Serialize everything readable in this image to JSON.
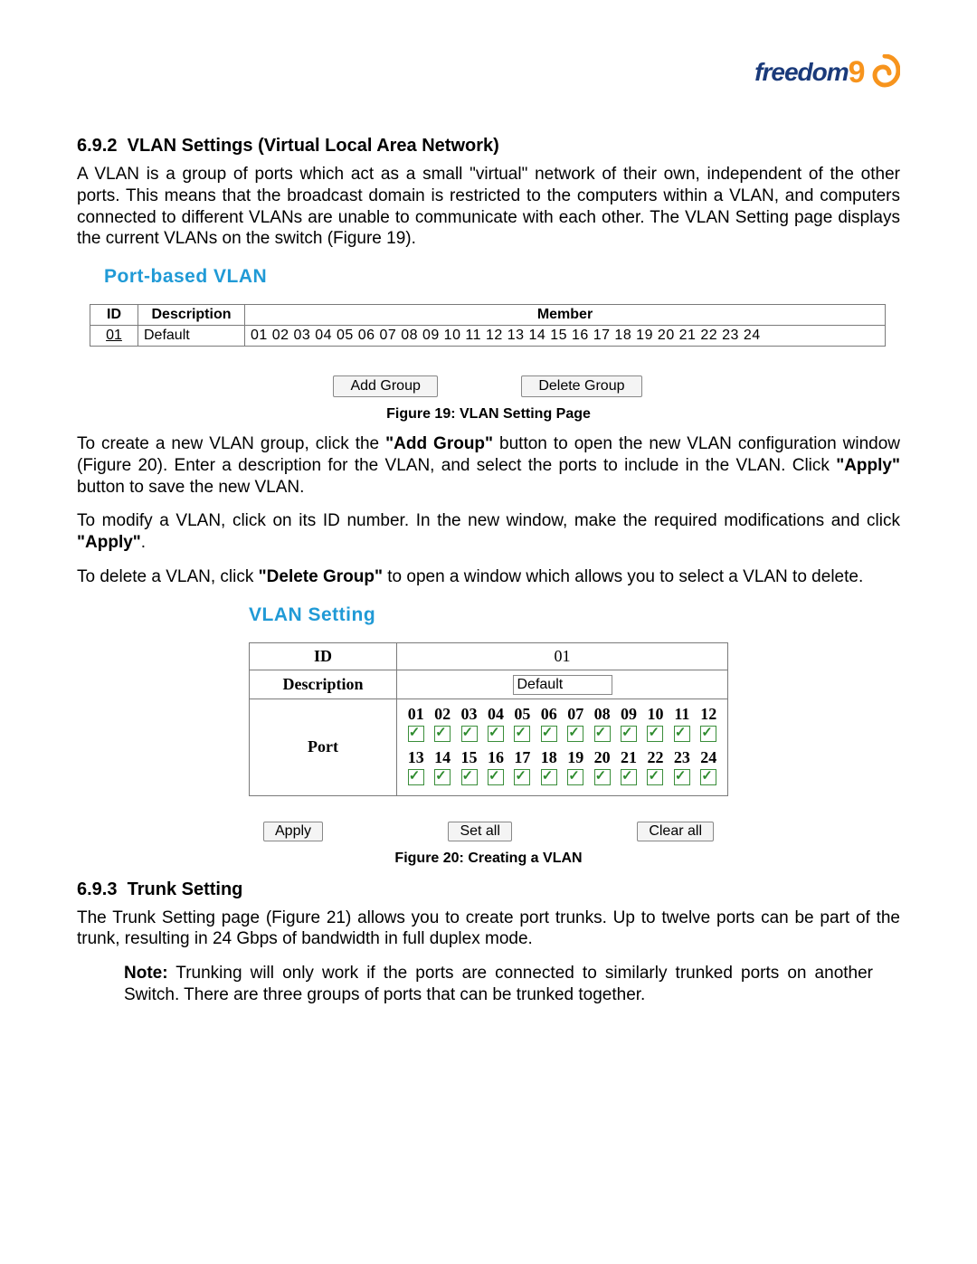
{
  "logo": {
    "brand": "freedom",
    "accent": "9"
  },
  "section_692": {
    "number": "6.9.2",
    "title": "VLAN Settings (Virtual Local Area Network)",
    "para": "A VLAN is a group of ports which act as a small \"virtual\" network of their own, independent of the other ports. This means that the broadcast domain is restricted to the computers within a VLAN, and computers connected to different VLANs are unable to communicate with each other.   The VLAN Setting page displays the current VLANs on the switch (Figure 19)."
  },
  "fig19": {
    "title": "Port-based VLAN",
    "headers": {
      "id": "ID",
      "desc": "Description",
      "member": "Member"
    },
    "row": {
      "id": "01",
      "desc": "Default",
      "member": "01 02 03 04 05 06 07 08 09 10 11 12 13 14 15 16 17 18 19 20 21 22 23 24"
    },
    "buttons": {
      "add": "Add Group",
      "del": "Delete Group"
    },
    "caption": "Figure 19: VLAN Setting Page"
  },
  "after_fig19": {
    "p1_a": "To create a new VLAN group, click the ",
    "p1_b": "\"Add Group\"",
    "p1_c": " button to open the new VLAN configuration window (Figure 20).  Enter a description for the VLAN, and select the ports to include in the VLAN.  Click ",
    "p1_d": "\"Apply\"",
    "p1_e": " button to save the new VLAN.",
    "p2_a": "To modify a VLAN, click on its ID number.  In the new window, make the required modifications and click ",
    "p2_b": "\"Apply\"",
    "p2_c": ".",
    "p3_a": "To delete a VLAN, click ",
    "p3_b": "\"Delete Group\"",
    "p3_c": " to open a window which allows you to select a VLAN to delete."
  },
  "fig20": {
    "title": "VLAN Setting",
    "labels": {
      "id": "ID",
      "desc": "Description",
      "port": "Port"
    },
    "id_value": "01",
    "desc_value": "Default",
    "ports_row1": [
      "01",
      "02",
      "03",
      "04",
      "05",
      "06",
      "07",
      "08",
      "09",
      "10",
      "11",
      "12"
    ],
    "ports_row2": [
      "13",
      "14",
      "15",
      "16",
      "17",
      "18",
      "19",
      "20",
      "21",
      "22",
      "23",
      "24"
    ],
    "buttons": {
      "apply": "Apply",
      "setall": "Set all",
      "clearall": "Clear all"
    },
    "caption": "Figure 20: Creating a VLAN"
  },
  "section_693": {
    "number": "6.9.3",
    "title": "Trunk Setting",
    "para": "The Trunk Setting page (Figure 21) allows you to create port trunks.  Up to twelve ports can be part of the trunk, resulting in 24 Gbps of bandwidth in full duplex mode.",
    "note_label": "Note:",
    "note_body": "  Trunking will only work if the ports are connected to similarly trunked ports on another Switch.  There are three groups of ports that can be trunked together."
  }
}
